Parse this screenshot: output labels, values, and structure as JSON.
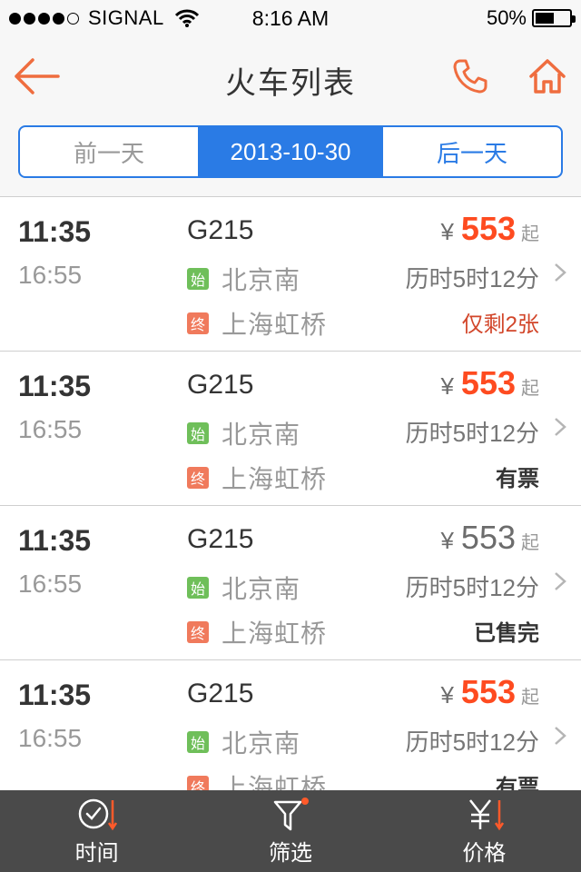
{
  "status_bar": {
    "carrier": "SIGNAL",
    "time": "8:16 AM",
    "battery": "50%"
  },
  "header": {
    "title": "火车列表"
  },
  "date_bar": {
    "prev": "前一天",
    "current": "2013-10-30",
    "next": "后一天"
  },
  "trains": [
    {
      "depart": "11:35",
      "arrive": "16:55",
      "code": "G215",
      "from_tag": "始",
      "from": "北京南",
      "to_tag": "终",
      "to": "上海虹桥",
      "currency": "¥",
      "price": "553",
      "price_suffix": "起",
      "duration": "历时5时12分",
      "availability": "仅剩2张",
      "status": "low"
    },
    {
      "depart": "11:35",
      "arrive": "16:55",
      "code": "G215",
      "from_tag": "始",
      "from": "北京南",
      "to_tag": "终",
      "to": "上海虹桥",
      "currency": "¥",
      "price": "553",
      "price_suffix": "起",
      "duration": "历时5时12分",
      "availability": "有票",
      "status": "ok"
    },
    {
      "depart": "11:35",
      "arrive": "16:55",
      "code": "G215",
      "from_tag": "始",
      "from": "北京南",
      "to_tag": "终",
      "to": "上海虹桥",
      "currency": "¥",
      "price": "553",
      "price_suffix": "起",
      "duration": "历时5时12分",
      "availability": "已售完",
      "status": "sold"
    },
    {
      "depart": "11:35",
      "arrive": "16:55",
      "code": "G215",
      "from_tag": "始",
      "from": "北京南",
      "to_tag": "终",
      "to": "上海虹桥",
      "currency": "¥",
      "price": "553",
      "price_suffix": "起",
      "duration": "历时5时12分",
      "availability": "有票",
      "status": "ok"
    }
  ],
  "tabbar": {
    "time": "时间",
    "filter": "筛选",
    "price": "价格"
  },
  "colors": {
    "accent": "#2a7be5",
    "price": "#fe4b20",
    "nav_icon": "#ef6d3f",
    "tabbar_bg": "#4a4a4a"
  }
}
